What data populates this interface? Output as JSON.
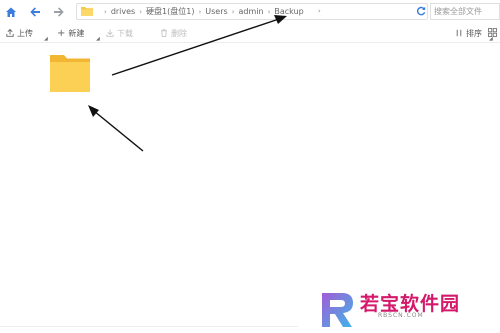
{
  "nav": {
    "home_icon": "home-icon",
    "back_icon": "back-arrow-icon",
    "forward_icon": "forward-arrow-icon",
    "folder_icon": "folder-icon",
    "refresh_icon": "refresh-icon"
  },
  "breadcrumbs": [
    "drives",
    "硬盘1(盘位1)",
    "Users",
    "admin",
    "Backup"
  ],
  "search": {
    "placeholder": "搜索全部文件"
  },
  "toolbar": {
    "upload_label": "上传",
    "new_label": "新建",
    "download_label": "下载",
    "delete_label": "删除",
    "sort_label": "排序"
  },
  "watermark": {
    "brand": "若宝软件园",
    "sub": "RBSCN.COM"
  },
  "colors": {
    "accent": "#3b7ddd",
    "folder": "#f7c948",
    "watermark": "#d4196b"
  }
}
